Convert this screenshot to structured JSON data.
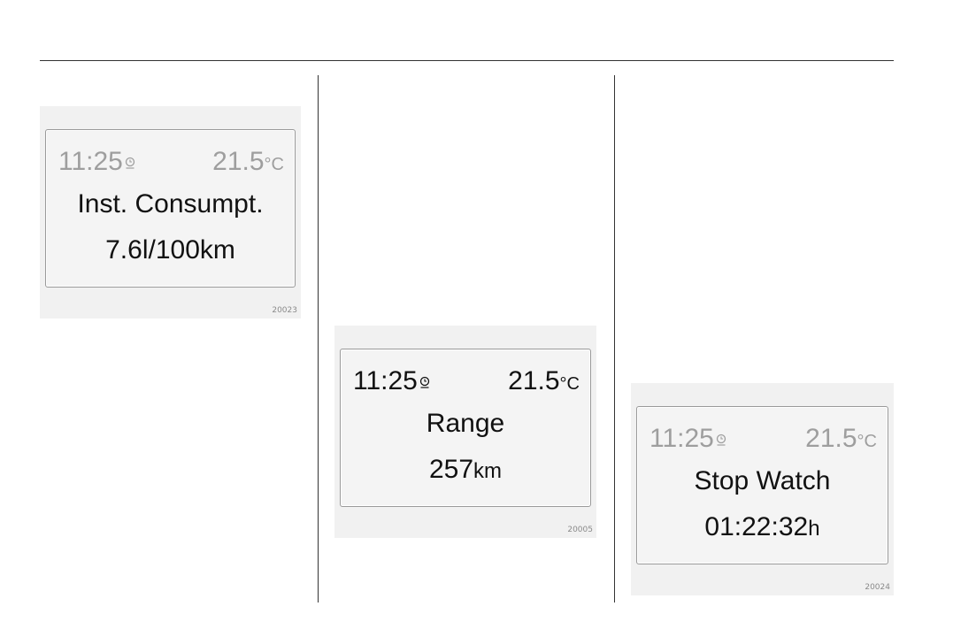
{
  "figures": [
    {
      "status": {
        "time": "11:25",
        "temp": "21.5",
        "temp_unit": "°C",
        "icon": "clock-rds-icon"
      },
      "title": "Inst. Consumpt.",
      "value": "7.6l/100km",
      "value_unit": "",
      "figure_id": "20023"
    },
    {
      "status": {
        "time": "11:25",
        "temp": "21.5",
        "temp_unit": "°C",
        "icon": "clock-rds-icon"
      },
      "title": "Range",
      "value": "257",
      "value_unit": "km",
      "figure_id": "20005"
    },
    {
      "status": {
        "time": "11:25",
        "temp": "21.5",
        "temp_unit": "°C",
        "icon": "clock-rds-icon"
      },
      "title": "Stop Watch",
      "value": "01:22:32",
      "value_unit": "h",
      "figure_id": "20024"
    }
  ],
  "colors": {
    "dim_text": "#9e9e9e",
    "text": "#111111",
    "panel": "#f1f1f1",
    "rule": "#333333"
  }
}
